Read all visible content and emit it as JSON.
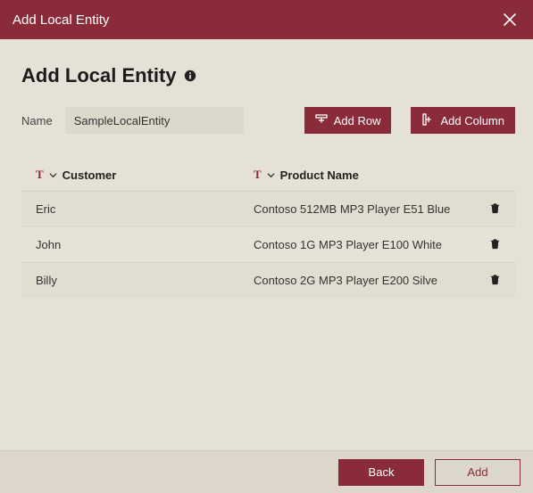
{
  "titlebar": {
    "title": "Add Local Entity"
  },
  "heading": "Add Local Entity",
  "name": {
    "label": "Name",
    "value": "SampleLocalEntity"
  },
  "buttons": {
    "add_row": "Add Row",
    "add_column": "Add Column",
    "back": "Back",
    "add": "Add"
  },
  "columns": {
    "customer": {
      "label": "Customer",
      "type": "T"
    },
    "product": {
      "label": "Product Name",
      "type": "T"
    }
  },
  "rows": [
    {
      "customer": "Eric",
      "product": "Contoso 512MB MP3 Player E51 Blue"
    },
    {
      "customer": "John",
      "product": "Contoso 1G MP3 Player E100 White"
    },
    {
      "customer": "Billy",
      "product": "Contoso 2G MP3 Player E200 Silve"
    }
  ],
  "colors": {
    "accent": "#8a2b3a",
    "bg": "#e6e1d6"
  }
}
